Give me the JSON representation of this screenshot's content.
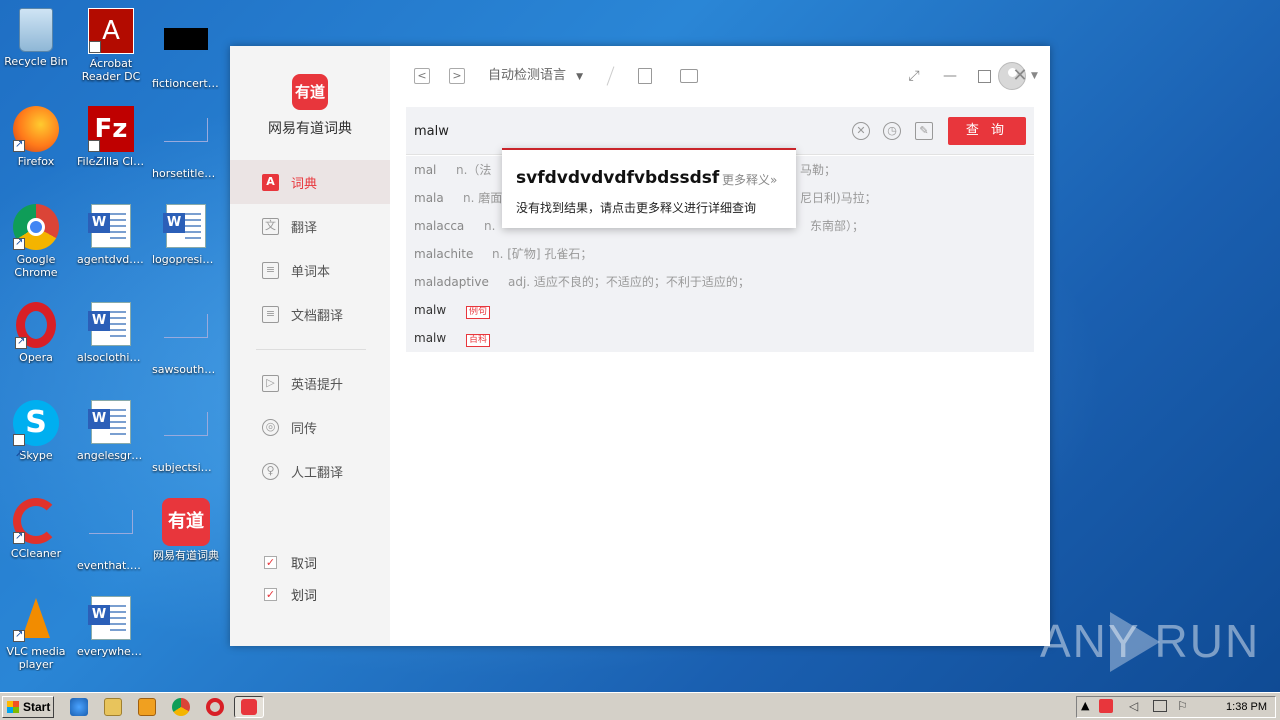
{
  "desktop": {
    "icons": [
      {
        "label": "Recycle Bin"
      },
      {
        "label": "Acrobat Reader DC"
      },
      {
        "label": "fictioncertai..."
      },
      {
        "label": "Firefox"
      },
      {
        "label": "FileZilla Client"
      },
      {
        "label": "horsetitles...."
      },
      {
        "label": "Google Chrome"
      },
      {
        "label": "agentdvd.rtf"
      },
      {
        "label": "logopreside..."
      },
      {
        "label": "Opera"
      },
      {
        "label": "alsoclothing..."
      },
      {
        "label": "sawsouthe..."
      },
      {
        "label": "Skype"
      },
      {
        "label": "angelesgre..."
      },
      {
        "label": "subjectsimp..."
      },
      {
        "label": "CCleaner"
      },
      {
        "label": "eventhat.png"
      },
      {
        "label": "网易有道词典"
      },
      {
        "label": "VLC media player"
      },
      {
        "label": "everywhet..."
      }
    ]
  },
  "app": {
    "logo_text": "有道",
    "name": "网易有道词典",
    "nav": [
      {
        "label": "词典",
        "icon": "A"
      },
      {
        "label": "翻译",
        "icon": "文"
      },
      {
        "label": "单词本",
        "icon": "≡"
      },
      {
        "label": "文档翻译",
        "icon": "≡"
      },
      {
        "label": "英语提升",
        "icon": "▷"
      },
      {
        "label": "同传",
        "icon": "◎"
      },
      {
        "label": "人工翻译",
        "icon": "♀"
      }
    ],
    "options": [
      {
        "label": "取词",
        "checked": true
      },
      {
        "label": "划词",
        "checked": true
      }
    ],
    "toolbar": {
      "back": "<",
      "forward": ">",
      "language": "自动检测语言",
      "dropdown": "▼"
    },
    "search": {
      "value": "malw",
      "button": "查 询"
    },
    "suggestions": [
      {
        "word": "mal",
        "def": "n.（法"
      },
      {
        "word": "mala",
        "def": "n. 磨面"
      },
      {
        "word": "malacca",
        "def": "n."
      },
      {
        "word": "malachite",
        "def": "n. [矿物] 孔雀石；"
      },
      {
        "word": "maladaptive",
        "def": "adj. 适应不良的；不适应的；不利于适应的；"
      },
      {
        "word": "malw",
        "tag": "例句"
      },
      {
        "word": "malw",
        "tag": "百科"
      }
    ],
    "suggestion_tails": [
      "马勒；",
      "尼日利)马拉；",
      "东南部）；"
    ],
    "popup": {
      "word": "svfdvdvdvdfvbdssdsf",
      "more": "更多释义»",
      "message": "没有找到结果，请点击更多释义进行详细查询"
    }
  },
  "watermark": "ANY RUN",
  "taskbar": {
    "start": "Start",
    "clock": "1:38 PM"
  }
}
